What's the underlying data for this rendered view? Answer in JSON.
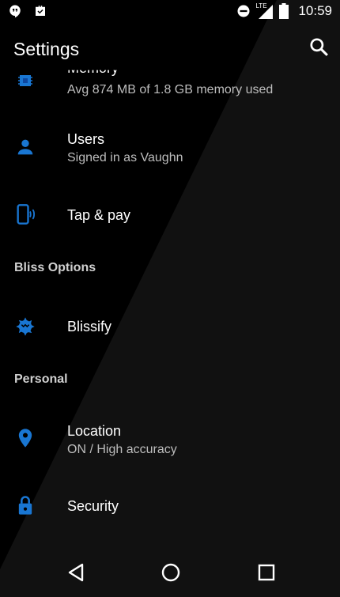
{
  "status_bar": {
    "time": "10:59",
    "network_type": "LTE",
    "icons_left": [
      "hangouts-icon",
      "briefcase-check-icon"
    ],
    "icons_right": [
      "do-not-disturb-icon",
      "signal-icon",
      "battery-icon"
    ]
  },
  "toolbar": {
    "title": "Settings"
  },
  "items": {
    "memory": {
      "title": "Memory",
      "subtitle": "Avg 874 MB of 1.8 GB memory used"
    },
    "users": {
      "title": "Users",
      "subtitle": "Signed in as Vaughn"
    },
    "tap_pay": {
      "title": "Tap & pay"
    },
    "blissify": {
      "title": "Blissify"
    },
    "location": {
      "title": "Location",
      "subtitle": "ON / High accuracy"
    },
    "security": {
      "title": "Security"
    }
  },
  "sections": {
    "bliss_options": "Bliss Options",
    "personal": "Personal"
  },
  "colors": {
    "accent": "#1976d2",
    "background": "#000000",
    "text": "#ffffff",
    "subtext": "#bdbdbd"
  }
}
